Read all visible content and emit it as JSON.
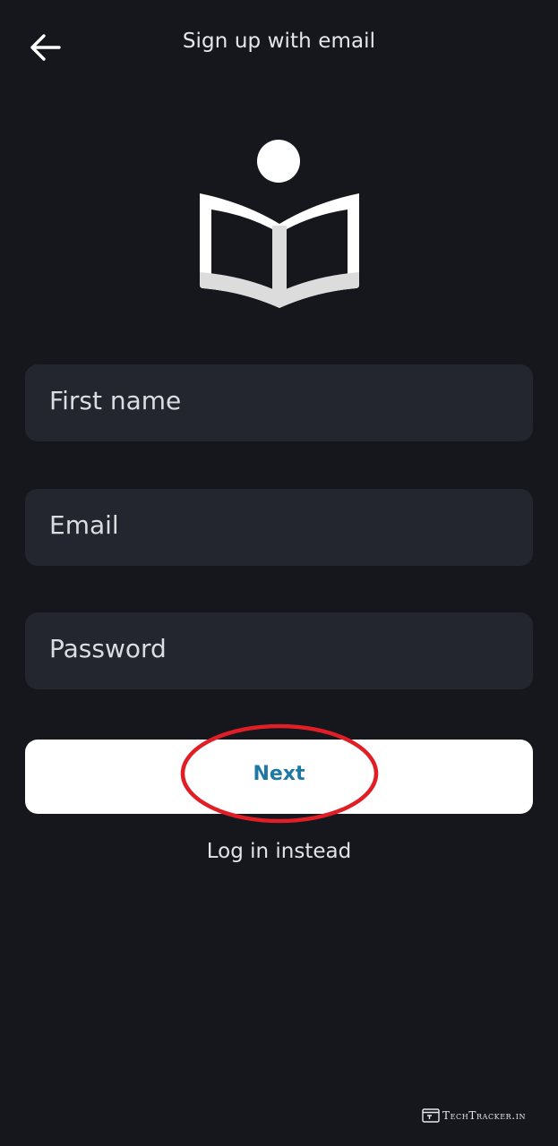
{
  "header": {
    "title": "Sign up with email",
    "back_icon": "arrow-left-icon"
  },
  "logo": {
    "icon": "reading-book-icon",
    "color": "#ffffff",
    "accent": "#dcdcdc"
  },
  "form": {
    "first_name": {
      "placeholder": "First name",
      "value": ""
    },
    "email": {
      "placeholder": "Email",
      "value": ""
    },
    "password": {
      "placeholder": "Password",
      "value": ""
    }
  },
  "actions": {
    "next_label": "Next",
    "login_label": "Log in instead"
  },
  "annotation": {
    "shape": "ellipse-highlight",
    "color": "#e01e26",
    "target": "next-button"
  },
  "watermark": {
    "text": "TechTracker.in",
    "icon": "browser-window-icon"
  },
  "colors": {
    "background": "#15171d",
    "field_background": "#23262f",
    "button_background": "#ffffff",
    "button_text": "#1e78a4"
  }
}
